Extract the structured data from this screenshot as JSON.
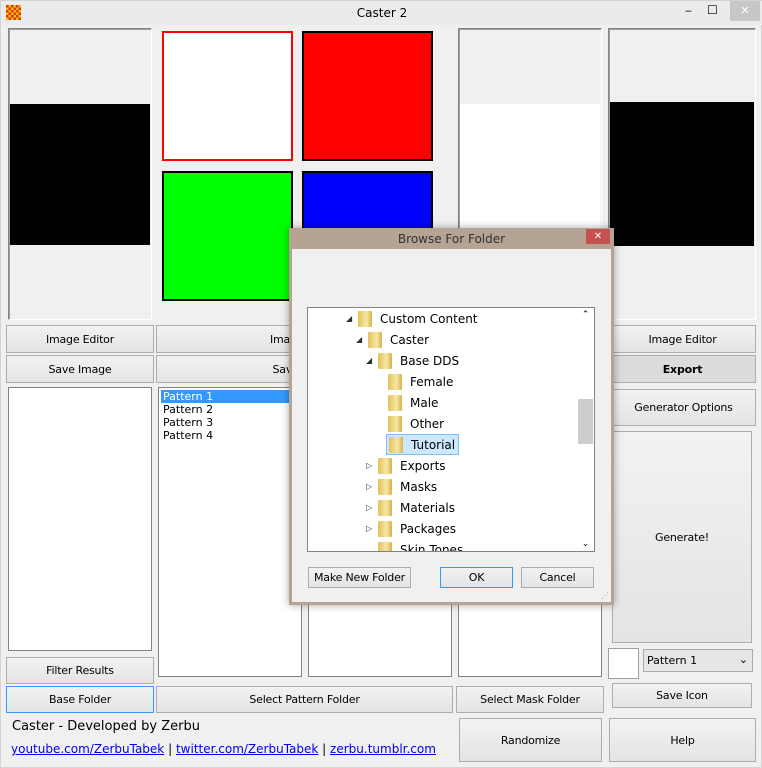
{
  "window": {
    "title": "Caster 2",
    "min": "‒",
    "max": "☐",
    "close": "✕"
  },
  "swatches": {
    "colors": [
      "#ffffff",
      "#ff0000",
      "#00ff00",
      "#0000ff"
    ],
    "selected_border": "#ff0000"
  },
  "buttons": {
    "image_editor_1": "Image Editor",
    "image_editor_2": "Image Editor",
    "image_editor_4": "Image Editor",
    "save_image_1": "Save Image",
    "save_image_2": "Save Image",
    "export": "Export",
    "generator_options": "Generator Options",
    "generate": "Generate!",
    "save_icon": "Save Icon",
    "filter_results": "Filter Results",
    "base_folder": "Base Folder",
    "select_pattern_folder": "Select Pattern Folder",
    "select_mask_folder": "Select Mask Folder",
    "randomize": "Randomize",
    "help": "Help"
  },
  "patterns": [
    "Pattern 1",
    "Pattern 2",
    "Pattern 3",
    "Pattern 4"
  ],
  "pattern_select": {
    "value": "Pattern 1"
  },
  "footer": {
    "credit": "Caster - Developed by Zerbu",
    "links": [
      "youtube.com/ZerbuTabek",
      "twitter.com/ZerbuTabek",
      "zerbu.tumblr.com"
    ],
    "sep": "|"
  },
  "dialog": {
    "title": "Browse For Folder",
    "close": "✕",
    "tree": [
      {
        "label": "Custom Content",
        "level": 0,
        "state": "expanded"
      },
      {
        "label": "Caster",
        "level": 1,
        "state": "expanded"
      },
      {
        "label": "Base DDS",
        "level": 2,
        "state": "expanded"
      },
      {
        "label": "Female",
        "level": 3,
        "state": "leaf"
      },
      {
        "label": "Male",
        "level": 3,
        "state": "leaf"
      },
      {
        "label": "Other",
        "level": 3,
        "state": "leaf"
      },
      {
        "label": "Tutorial",
        "level": 3,
        "state": "selected"
      },
      {
        "label": "Exports",
        "level": 2,
        "state": "collapsed"
      },
      {
        "label": "Masks",
        "level": 2,
        "state": "collapsed"
      },
      {
        "label": "Materials",
        "level": 2,
        "state": "collapsed"
      },
      {
        "label": "Packages",
        "level": 2,
        "state": "collapsed"
      },
      {
        "label": "Skin Tones",
        "level": 2,
        "state": "leaf"
      }
    ],
    "make_new_folder": "Make New Folder",
    "ok": "OK",
    "cancel": "Cancel"
  }
}
